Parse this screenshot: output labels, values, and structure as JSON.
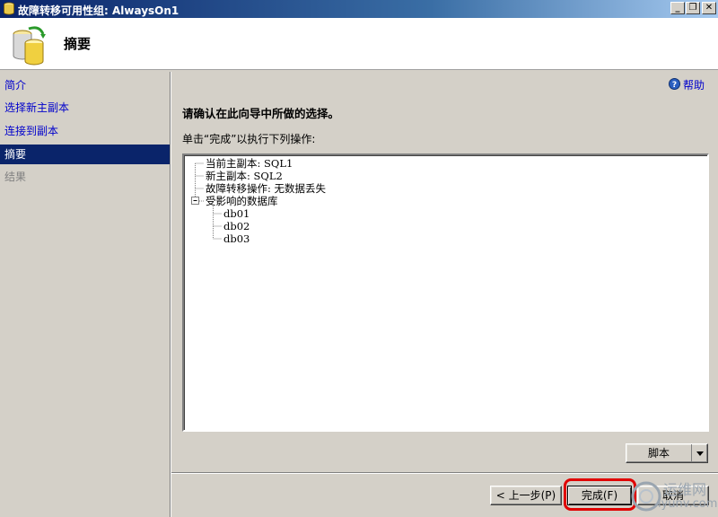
{
  "window": {
    "title": "故障转移可用性组: AlwaysOn1",
    "minimize": "_",
    "restore": "❐",
    "close": "✕"
  },
  "header": {
    "title": "摘要"
  },
  "sidebar": {
    "items": [
      {
        "label": "简介",
        "state": "link"
      },
      {
        "label": "选择新主副本",
        "state": "link"
      },
      {
        "label": "连接到副本",
        "state": "link"
      },
      {
        "label": "摘要",
        "state": "selected"
      },
      {
        "label": "结果",
        "state": "disabled"
      }
    ]
  },
  "main": {
    "help_label": "帮助",
    "heading": "请确认在此向导中所做的选择。",
    "instruction": "单击“完成”以执行下列操作:",
    "tree": [
      {
        "label": "当前主副本: SQL1",
        "level": 0
      },
      {
        "label": "新主副本: SQL2",
        "level": 0
      },
      {
        "label": "故障转移操作: 无数据丢失",
        "level": 0
      },
      {
        "label": "受影响的数据库",
        "level": 0,
        "expander": "−"
      },
      {
        "label": "db01",
        "level": 1
      },
      {
        "label": "db02",
        "level": 1
      },
      {
        "label": "db03",
        "level": 1
      }
    ],
    "script_button": "脚本"
  },
  "footer": {
    "prev_button": "< 上一步(P)",
    "finish_button": "完成(F)",
    "cancel_button": "取消"
  },
  "watermark": {
    "text": "运维网",
    "url": "iyunv.com"
  },
  "colors": {
    "selected_bg": "#0a246a",
    "link": "#0000cc",
    "highlight": "#e00000",
    "title_gradient_start": "#0a246a"
  },
  "icons": [
    "app-database-icon",
    "database-sync-icon",
    "help-icon",
    "dropdown-arrow-icon"
  ]
}
